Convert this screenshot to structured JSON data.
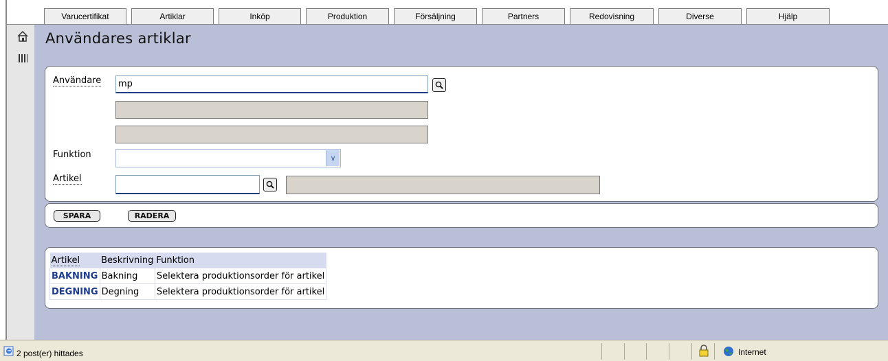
{
  "nav": {
    "tabs": [
      {
        "label": "Varucertifikat"
      },
      {
        "label": "Artiklar"
      },
      {
        "label": "Inköp"
      },
      {
        "label": "Produktion"
      },
      {
        "label": "Försäljning"
      },
      {
        "label": "Partners"
      },
      {
        "label": "Redovisning"
      },
      {
        "label": "Diverse"
      },
      {
        "label": "Hjälp"
      }
    ]
  },
  "rail": {
    "icons": [
      "home-icon",
      "list-view-icon"
    ]
  },
  "page": {
    "title": "Användares artiklar"
  },
  "form": {
    "user_label": "Användare",
    "user_value": "mp",
    "function_label": "Funktion",
    "function_value": "",
    "article_label": "Artikel",
    "article_value": ""
  },
  "actions": {
    "save_label": "SPARA",
    "delete_label": "RADERA"
  },
  "table": {
    "headers": [
      "Artikel",
      "Beskrivning",
      "Funktion"
    ],
    "rows": [
      {
        "article": "BAKNING",
        "description": "Bakning",
        "function": "Selektera produktionsorder för artikel"
      },
      {
        "article": "DEGNING",
        "description": "Degning",
        "function": "Selektera produktionsorder för artikel"
      }
    ]
  },
  "status": {
    "message": "2 post(er) hittades",
    "zone": "Internet"
  },
  "colors": {
    "content_bg": "#b9bfd6",
    "link": "#1d3b8f",
    "header_bg": "#d7dbef"
  }
}
